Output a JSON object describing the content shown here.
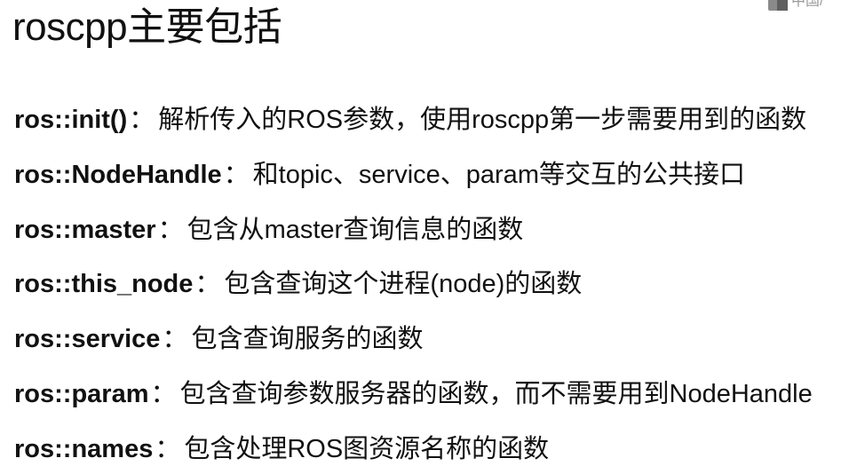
{
  "slide": {
    "title": "roscpp主要包括",
    "corner_text": "中国/"
  },
  "items": [
    {
      "name": "ros::init()",
      "separator": "：",
      "description": "解析传入的ROS参数，使用roscpp第一步需要用到的函数"
    },
    {
      "name": "ros::NodeHandle",
      "separator": "：",
      "description": "和topic、service、param等交互的公共接口"
    },
    {
      "name": "ros::master",
      "separator": "：",
      "description": "包含从master查询信息的函数"
    },
    {
      "name": "ros::this_node",
      "separator": "：",
      "description": "包含查询这个进程(node)的函数"
    },
    {
      "name": "ros::service",
      "separator": "：",
      "description": "包含查询服务的函数"
    },
    {
      "name": "ros::param",
      "separator": "：",
      "description": "包含查询参数服务器的函数，而不需要用到NodeHandle"
    },
    {
      "name": "ros::names",
      "separator": "：",
      "description": "包含处理ROS图资源名称的函数"
    }
  ],
  "colors": {
    "background": "#ffffff",
    "text": "#111111",
    "logo": "#8a8a8a"
  }
}
